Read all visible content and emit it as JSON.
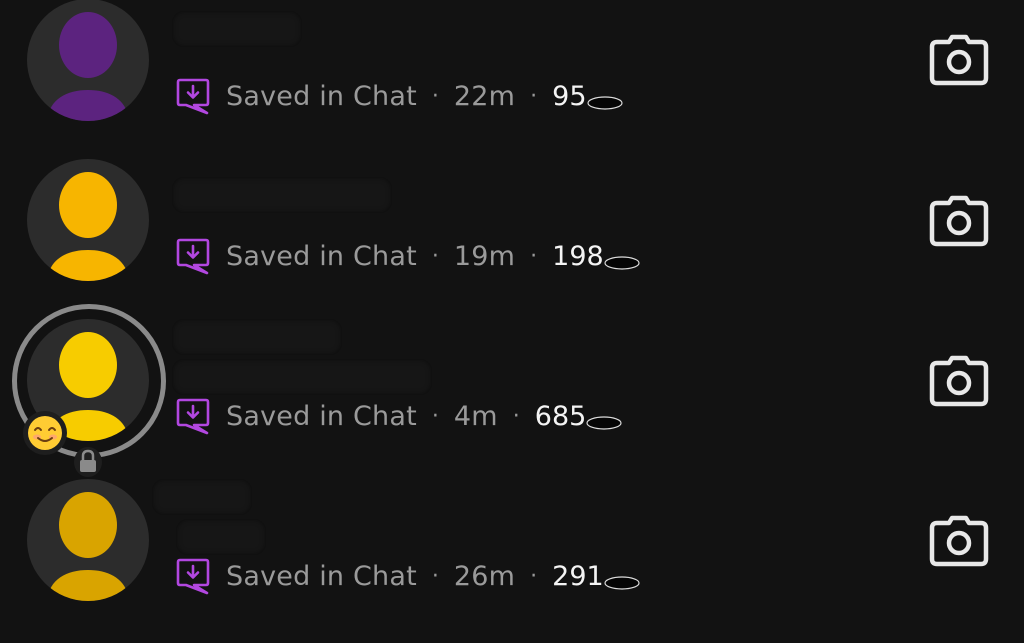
{
  "colors": {
    "background": "#121212",
    "avatar_bg": "#2c2c2c",
    "meta_text": "#9a9a9a",
    "score_text": "#f4f4f4",
    "saved_icon": "#b247e0",
    "camera_icon": "#e8e8e8",
    "story_ring": "#8a8a8a"
  },
  "conversations": [
    {
      "avatar_icon": "bitmoji-silhouette-icon",
      "avatar_color": "#5c237f",
      "status": "Saved in Chat",
      "time": "22m",
      "separator": "·",
      "score": "95"
    },
    {
      "avatar_icon": "bitmoji-silhouette-icon",
      "avatar_color": "#f7b500",
      "status": "Saved in Chat",
      "time": "19m",
      "separator": "·",
      "score": "198"
    },
    {
      "avatar_icon": "bitmoji-silhouette-icon",
      "avatar_color": "#f7cc00",
      "status": "Saved in Chat",
      "time": "4m",
      "separator": "·",
      "score": "685",
      "badges": [
        "smiling-face-emoji-icon",
        "lock-icon"
      ]
    },
    {
      "avatar_icon": "bitmoji-silhouette-icon",
      "avatar_color": "#d9a400",
      "status": "Saved in Chat",
      "time": "26m",
      "separator": "·",
      "score": "291"
    }
  ]
}
